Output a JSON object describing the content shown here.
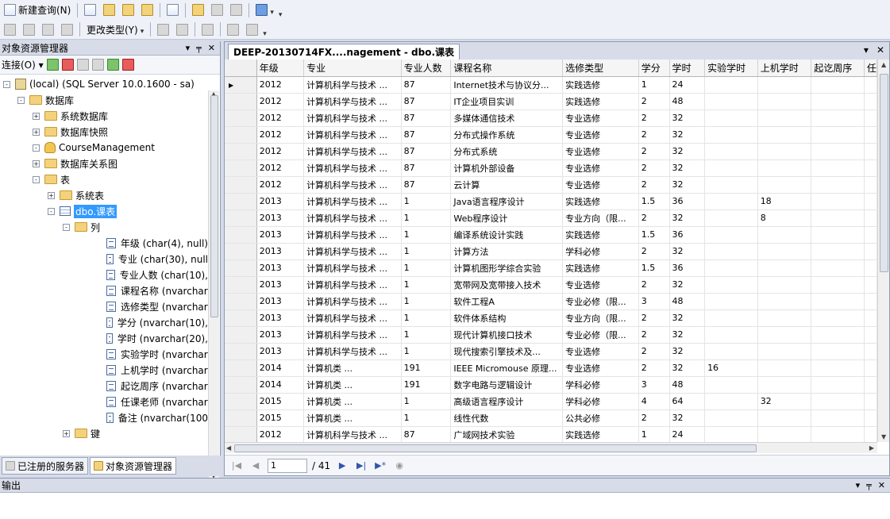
{
  "toolbar1": {
    "new_query_label": "新建查询(N)"
  },
  "toolbar2": {
    "change_type_label": "更改类型(Y)"
  },
  "object_explorer": {
    "title": "对象资源管理器",
    "connect_label": "连接(O)",
    "tree": [
      {
        "label": "(local) (SQL Server 10.0.1600 - sa)",
        "level": 0,
        "exp": "-",
        "icon": "server"
      },
      {
        "label": "数据库",
        "level": 1,
        "exp": "-",
        "icon": "folder"
      },
      {
        "label": "系统数据库",
        "level": 2,
        "exp": "+",
        "icon": "folder"
      },
      {
        "label": "数据库快照",
        "level": 2,
        "exp": "+",
        "icon": "folder"
      },
      {
        "label": "CourseManagement",
        "level": 2,
        "exp": "-",
        "icon": "database"
      },
      {
        "label": "数据库关系图",
        "level": 3,
        "exp": "+",
        "icon": "folder"
      },
      {
        "label": "表",
        "level": 3,
        "exp": "-",
        "icon": "folder"
      },
      {
        "label": "系统表",
        "level": 4,
        "exp": "+",
        "icon": "folder"
      },
      {
        "label": "dbo.课表",
        "level": 4,
        "exp": "-",
        "icon": "table",
        "selected": true
      },
      {
        "label": "列",
        "level": 5,
        "exp": "-",
        "icon": "folder"
      },
      {
        "label": "年级 (char(4), null)",
        "level": 6,
        "exp": "",
        "icon": "column"
      },
      {
        "label": "专业 (char(30), null",
        "level": 6,
        "exp": "",
        "icon": "column"
      },
      {
        "label": "专业人数 (char(10),",
        "level": 6,
        "exp": "",
        "icon": "column"
      },
      {
        "label": "课程名称 (nvarchar",
        "level": 6,
        "exp": "",
        "icon": "column"
      },
      {
        "label": "选修类型 (nvarchar",
        "level": 6,
        "exp": "",
        "icon": "column"
      },
      {
        "label": "学分 (nvarchar(10),",
        "level": 6,
        "exp": "",
        "icon": "column"
      },
      {
        "label": "学时 (nvarchar(20),",
        "level": 6,
        "exp": "",
        "icon": "column"
      },
      {
        "label": "实验学时 (nvarchar",
        "level": 6,
        "exp": "",
        "icon": "column"
      },
      {
        "label": "上机学时 (nvarchar",
        "level": 6,
        "exp": "",
        "icon": "column"
      },
      {
        "label": "起讫周序 (nvarchar",
        "level": 6,
        "exp": "",
        "icon": "column"
      },
      {
        "label": "任课老师 (nvarchar",
        "level": 6,
        "exp": "",
        "icon": "column"
      },
      {
        "label": "备注 (nvarchar(100",
        "level": 6,
        "exp": "",
        "icon": "column"
      },
      {
        "label": "键",
        "level": 5,
        "exp": "+",
        "icon": "folder"
      }
    ]
  },
  "bottom_tabs": {
    "registered_servers": "已注册的服务器",
    "object_explorer": "对象资源管理器"
  },
  "document": {
    "tab_title": "DEEP-20130714FX....nagement - dbo.课表",
    "columns": [
      "年级",
      "专业",
      "专业人数",
      "课程名称",
      "选修类型",
      "学分",
      "学时",
      "实验学时",
      "上机学时",
      "起讫周序",
      "任"
    ],
    "rows": [
      [
        "2012",
        "计算机科学与技术 ...",
        "87",
        "Internet技术与协议分...",
        "实践选修",
        "1",
        "24",
        "",
        "",
        ""
      ],
      [
        "2012",
        "计算机科学与技术 ...",
        "87",
        "IT企业项目实训",
        "实践选修",
        "2",
        "48",
        "",
        "",
        ""
      ],
      [
        "2012",
        "计算机科学与技术 ...",
        "87",
        "多媒体通信技术",
        "专业选修",
        "2",
        "32",
        "",
        "",
        ""
      ],
      [
        "2012",
        "计算机科学与技术 ...",
        "87",
        "分布式操作系统",
        "专业选修",
        "2",
        "32",
        "",
        "",
        ""
      ],
      [
        "2012",
        "计算机科学与技术 ...",
        "87",
        "分布式系统",
        "专业选修",
        "2",
        "32",
        "",
        "",
        ""
      ],
      [
        "2012",
        "计算机科学与技术 ...",
        "87",
        "计算机外部设备",
        "专业选修",
        "2",
        "32",
        "",
        "",
        ""
      ],
      [
        "2012",
        "计算机科学与技术 ...",
        "87",
        "云计算",
        "专业选修",
        "2",
        "32",
        "",
        "",
        ""
      ],
      [
        "2013",
        "计算机科学与技术 ...",
        "1",
        "Java语言程序设计",
        "实践选修",
        "1.5",
        "36",
        "",
        "18",
        ""
      ],
      [
        "2013",
        "计算机科学与技术 ...",
        "1",
        "Web程序设计",
        "专业方向（限...",
        "2",
        "32",
        "",
        "8",
        ""
      ],
      [
        "2013",
        "计算机科学与技术 ...",
        "1",
        "编译系统设计实践",
        "实践选修",
        "1.5",
        "36",
        "",
        "",
        ""
      ],
      [
        "2013",
        "计算机科学与技术 ...",
        "1",
        "计算方法",
        "学科必修",
        "2",
        "32",
        "",
        "",
        ""
      ],
      [
        "2013",
        "计算机科学与技术 ...",
        "1",
        "计算机图形学综合实验",
        "实践选修",
        "1.5",
        "36",
        "",
        "",
        ""
      ],
      [
        "2013",
        "计算机科学与技术 ...",
        "1",
        "宽带网及宽带接入技术",
        "专业选修",
        "2",
        "32",
        "",
        "",
        ""
      ],
      [
        "2013",
        "计算机科学与技术 ...",
        "1",
        "软件工程A",
        "专业必修（限...",
        "3",
        "48",
        "",
        "",
        ""
      ],
      [
        "2013",
        "计算机科学与技术 ...",
        "1",
        "软件体系结构",
        "专业方向（限...",
        "2",
        "32",
        "",
        "",
        ""
      ],
      [
        "2013",
        "计算机科学与技术 ...",
        "1",
        "现代计算机接口技术",
        "专业必修（限...",
        "2",
        "32",
        "",
        "",
        ""
      ],
      [
        "2013",
        "计算机科学与技术 ...",
        "1",
        "现代搜索引擎技术及...",
        "专业选修",
        "2",
        "32",
        "",
        "",
        ""
      ],
      [
        "2014",
        "计算机类          ...",
        "191",
        "IEEE Micromouse 原理...",
        "专业选修",
        "2",
        "32",
        "16",
        "",
        ""
      ],
      [
        "2014",
        "计算机类          ...",
        "191",
        "数字电路与逻辑设计",
        "学科必修",
        "3",
        "48",
        "",
        "",
        ""
      ],
      [
        "2015",
        "计算机类          ...",
        "1",
        "高级语言程序设计",
        "学科必修",
        "4",
        "64",
        "",
        "32",
        ""
      ],
      [
        "2015",
        "计算机类          ...",
        "1",
        "线性代数",
        "公共必修",
        "2",
        "32",
        "",
        "",
        ""
      ],
      [
        "2012",
        "计算机科学与技术 ...",
        "87",
        "广域网技术实验",
        "实践选修",
        "1",
        "24",
        "",
        "",
        ""
      ]
    ],
    "pager": {
      "current": "1",
      "total": "/ 41"
    }
  },
  "output": {
    "title": "输出"
  }
}
